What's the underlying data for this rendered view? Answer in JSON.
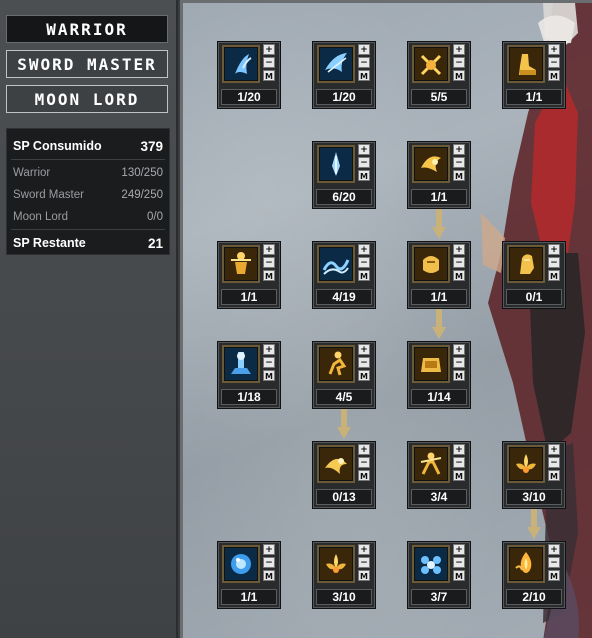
{
  "class_tabs": [
    {
      "label": "WARRIOR",
      "active": true
    },
    {
      "label": "SWORD MASTER",
      "active": false
    },
    {
      "label": "MOON LORD",
      "active": false
    }
  ],
  "sp_panel": {
    "consumed_label": "SP Consumido",
    "consumed_value": "379",
    "rows": [
      {
        "label": "Warrior",
        "value": "130/250"
      },
      {
        "label": "Sword Master",
        "value": "249/250"
      },
      {
        "label": "Moon Lord",
        "value": "0/0"
      }
    ],
    "remaining_label": "SP Restante",
    "remaining_value": "21"
  },
  "skill_buttons": {
    "plus": "+",
    "minus": "−",
    "max": "M"
  },
  "skills": [
    {
      "level": "1/20",
      "icon": "blue-slash-icon",
      "tone": "blue"
    },
    {
      "level": "1/20",
      "icon": "blue-wing-icon",
      "tone": "blue"
    },
    {
      "level": "5/5",
      "icon": "golden-swords-icon",
      "tone": "gold"
    },
    {
      "level": "1/1",
      "icon": "golden-boot-icon",
      "tone": "gold"
    },
    {
      "level": "6/20",
      "icon": "blue-blade-icon",
      "tone": "blue"
    },
    {
      "level": "1/1",
      "icon": "golden-strike-icon",
      "tone": "gold"
    },
    {
      "level": "1/1",
      "icon": "golden-figure-icon",
      "tone": "gold"
    },
    {
      "level": "4/19",
      "icon": "blue-wave-icon",
      "tone": "blue"
    },
    {
      "level": "1/1",
      "icon": "golden-fist-icon",
      "tone": "gold"
    },
    {
      "level": "0/1",
      "icon": "golden-arm-icon",
      "tone": "gold"
    },
    {
      "level": "1/18",
      "icon": "blue-pillar-icon",
      "tone": "blue"
    },
    {
      "level": "4/5",
      "icon": "golden-runner-icon",
      "tone": "gold"
    },
    {
      "level": "1/14",
      "icon": "golden-gauntlet-icon",
      "tone": "gold"
    },
    {
      "level": "0/13",
      "icon": "golden-burst-icon",
      "tone": "gold"
    },
    {
      "level": "3/4",
      "icon": "golden-warrior-icon",
      "tone": "gold"
    },
    {
      "level": "3/10",
      "icon": "golden-lotus-icon",
      "tone": "gold"
    },
    {
      "level": "1/1",
      "icon": "blue-orb-icon",
      "tone": "blue"
    },
    {
      "level": "3/10",
      "icon": "golden-lotus-icon",
      "tone": "gold"
    },
    {
      "level": "3/7",
      "icon": "blue-flower-icon",
      "tone": "blue"
    },
    {
      "level": "2/10",
      "icon": "golden-flame-icon",
      "tone": "gold"
    }
  ],
  "colors": {
    "gold": "#f0c040",
    "blue": "#5ab4ff",
    "arrow": "#c9b27a"
  }
}
